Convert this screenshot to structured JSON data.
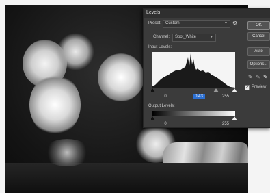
{
  "dialog": {
    "title": "Levels",
    "preset_label": "Preset:",
    "preset_value": "Custom",
    "channel_label": "Channel:",
    "channel_value": "Spot_White",
    "input_levels_label": "Input Levels:",
    "input_black": "0",
    "input_gamma": "0,43",
    "input_white": "255",
    "output_levels_label": "Output Levels:",
    "output_black": "0",
    "output_white": "255",
    "buttons": {
      "ok": "OK",
      "cancel": "Cancel",
      "auto": "Auto",
      "options": "Options..."
    },
    "preview_label": "Preview",
    "preview_checked": true
  },
  "colors": {
    "dialog_bg": "#3b3b3b",
    "highlight": "#2c6fd1"
  }
}
